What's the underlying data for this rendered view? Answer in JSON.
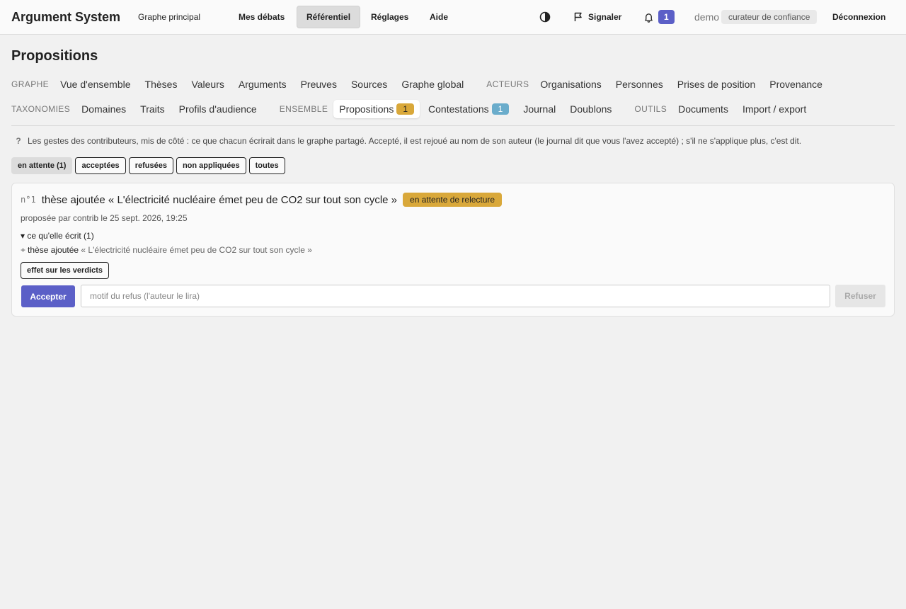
{
  "header": {
    "brand": "Argument System",
    "graph_link": "Graphe principal",
    "nav": [
      "Mes débats",
      "Référentiel",
      "Réglages",
      "Aide"
    ],
    "active_nav": "Référentiel",
    "report_label": "Signaler",
    "notification_count": "1",
    "user": "demo",
    "role": "curateur de confiance",
    "logout_label": "Déconnexion",
    "icons": {
      "theme": "contrast-icon",
      "report": "flag-icon",
      "notifications": "bell-icon"
    },
    "colors": {
      "accent": "#5b5fc7"
    }
  },
  "page": {
    "title": "Propositions",
    "tabs_row1": {
      "group1": "GRAPHE",
      "items1": [
        "Vue d'ensemble",
        "Thèses",
        "Valeurs",
        "Arguments",
        "Preuves",
        "Sources",
        "Graphe global"
      ],
      "group2": "ACTEURS",
      "items2": [
        "Organisations",
        "Personnes",
        "Prises de position",
        "Provenance"
      ]
    },
    "tabs_row2": {
      "group1": "TAXONOMIES",
      "items1": [
        "Domaines",
        "Traits",
        "Profils d'audience"
      ],
      "group2": "ENSEMBLE",
      "propositions": "Propositions",
      "propositions_count": "1",
      "contestations": "Contestations",
      "contestations_count": "1",
      "journal": "Journal",
      "doublons": "Doublons",
      "group3": "OUTILS",
      "items3": [
        "Documents",
        "Import / export"
      ]
    },
    "badge_colors": {
      "propositions": "#d9a83a",
      "contestations": "#6aaccb"
    },
    "info_mark": "?",
    "info_text": "Les gestes des contributeurs, mis de côté : ce que chacun écrirait dans le graphe partagé. Accepté, il est rejoué au nom de son auteur (le journal dit que vous l'avez accepté) ; s'il ne s'applique plus, c'est dit.",
    "filters": [
      "en attente (1)",
      "acceptées",
      "refusées",
      "non appliquées",
      "toutes"
    ],
    "active_filter": "en attente (1)"
  },
  "proposal": {
    "number": "n°1",
    "title": "thèse ajoutée « L'électricité nucléaire émet peu de CO2 sur tout son cycle »",
    "status": "en attente de relecture",
    "status_color": "#d9a83a",
    "meta": "proposée par contrib le 25 sept. 2026, 19:25",
    "details_summary": "▾ ce qu'elle écrit (1)",
    "change_sign": "+",
    "change_kind": "thèse ajoutée",
    "change_value": "« L'électricité nucléaire émet peu de CO2 sur tout son cycle »",
    "effect_label": "effet sur les verdicts",
    "accept_label": "Accepter",
    "reason_placeholder": "motif du refus (l'auteur le lira)",
    "refuse_label": "Refuser"
  }
}
